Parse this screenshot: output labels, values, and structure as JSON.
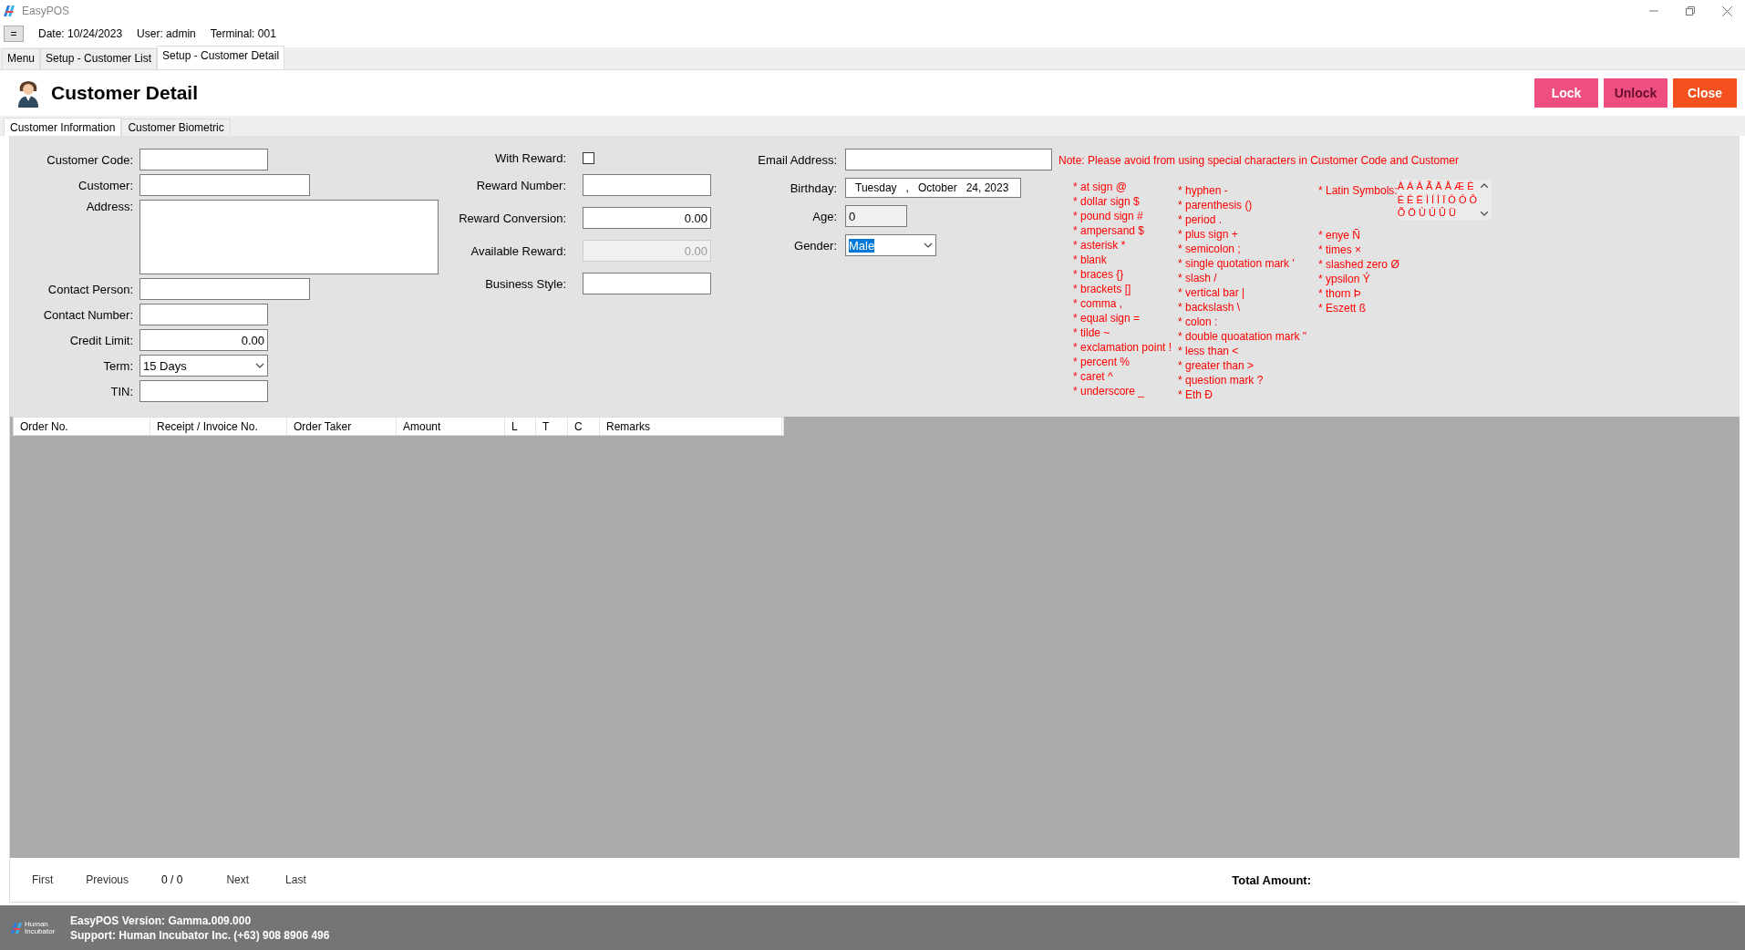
{
  "window": {
    "title": "EasyPOS"
  },
  "info_bar": {
    "menu_button": "=",
    "date": "Date: 10/24/2023",
    "user": "User: admin",
    "terminal": "Terminal: 001"
  },
  "tabs": [
    {
      "label": "Menu",
      "selected": false
    },
    {
      "label": "Setup - Customer List",
      "selected": false
    },
    {
      "label": "Setup - Customer Detail",
      "selected": true
    }
  ],
  "header": {
    "title": "Customer Detail",
    "buttons": [
      {
        "label": "Lock",
        "kind": "pink",
        "disabled": false
      },
      {
        "label": "Unlock",
        "kind": "pink",
        "disabled": true
      },
      {
        "label": "Close",
        "kind": "orange",
        "disabled": false
      }
    ]
  },
  "subtabs": [
    {
      "label": "Customer Information",
      "selected": true
    },
    {
      "label": "Customer Biometric",
      "selected": false
    }
  ],
  "form_columns": [
    [
      {
        "label": "Customer Code:",
        "kind": "text"
      },
      {
        "label": "Customer:",
        "kind": "text"
      },
      {
        "label": "Address:",
        "kind": "textarea"
      },
      {
        "label": "Contact Person:",
        "kind": "text"
      },
      {
        "label": "Contact Number:",
        "kind": "text"
      },
      {
        "label": "Credit Limit:",
        "kind": "number",
        "value": "0.00"
      },
      {
        "label": "Term:",
        "kind": "select",
        "value": "15 Days"
      },
      {
        "label": "TIN:",
        "kind": "text"
      }
    ],
    [
      {
        "label": "With Reward:",
        "kind": "checkbox",
        "checked": false
      },
      {
        "label": "Reward Number:",
        "kind": "text"
      },
      {
        "label": "Reward Conversion:",
        "kind": "number",
        "value": "0.00"
      },
      {
        "label": "Available Reward:",
        "kind": "number",
        "value": "0.00",
        "disabled": true
      },
      {
        "label": "Business Style:",
        "kind": "text"
      }
    ],
    [
      {
        "label": "Email Address:",
        "kind": "text"
      },
      {
        "label": "Birthday:",
        "kind": "date",
        "parts": [
          "Tuesday",
          ",",
          "October",
          "24, 2023"
        ]
      },
      {
        "label": "Age:",
        "kind": "readonly",
        "value": "0"
      },
      {
        "label": "Gender:",
        "kind": "select",
        "value": "Male",
        "highlighted": true
      }
    ]
  ],
  "note": {
    "text": "Note: Please avoid from using special characters in Customer Code and Customer",
    "columns": [
      [
        "* at sign @",
        "* dollar sign $",
        "* pound sign #",
        "* ampersand $",
        "* asterisk *",
        "* blank",
        "* braces {}",
        "* brackets []",
        "* comma ,",
        "* equal sign =",
        "*  tilde ~",
        "* exclamation point !",
        "* percent %",
        "* caret ^",
        "* underscore _"
      ],
      [
        "* hyphen -",
        "* parenthesis ()",
        "* period .",
        "* plus sign +",
        "* semicolon ;",
        "* single quotation mark '",
        "* slash /",
        "* vertical bar |",
        "* backslash \\",
        "* colon :",
        "* double quoatation mark \"",
        "* less than <",
        "* greater than >",
        "* question mark ?",
        "* Eth Ð"
      ],
      [
        "* enye Ñ",
        "* times ×",
        "* slashed zero Ø",
        "* ypsilon Ý",
        "* thorn Þ",
        "* Eszett ß"
      ]
    ],
    "latin_symbols": {
      "label": "* Latin Symbols:",
      "lines": [
        "À Á Â Ã Ä Å Æ È",
        "É Ê Ë Ì Í Î Ï Ò Ó Ô",
        "Õ Ö Ù Ú Û Ü"
      ]
    }
  },
  "table": {
    "columns": [
      "Order No.",
      "Receipt / Invoice No.",
      "Order Taker",
      "Amount",
      "L",
      "T",
      "C",
      "Remarks"
    ]
  },
  "pager": {
    "first": "First",
    "previous": "Previous",
    "position": "0 / 0",
    "next": "Next",
    "last": "Last",
    "total_label": "Total Amount:"
  },
  "status_bar": {
    "logo_text": "Human Incubator",
    "version": "EasyPOS Version: Gamma.009.000",
    "support": "Support: Human Incubator Inc. (+63) 908 8906 496"
  }
}
